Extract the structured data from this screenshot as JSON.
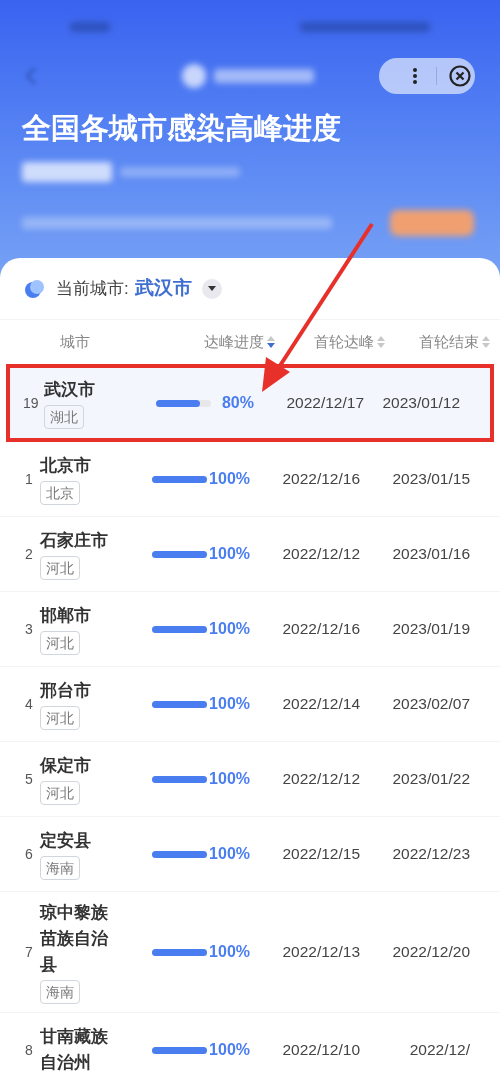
{
  "header": {
    "title": "全国各城市感染高峰进度"
  },
  "current_city": {
    "label": "当前城市:",
    "value": "武汉市"
  },
  "columns": [
    {
      "label": "城市",
      "sorted": false,
      "sortable": false
    },
    {
      "label": "达峰进度",
      "sorted": true,
      "sortable": true
    },
    {
      "label": "首轮达峰",
      "sorted": false,
      "sortable": true
    },
    {
      "label": "首轮结束",
      "sorted": false,
      "sortable": true
    }
  ],
  "rows": [
    {
      "rank": "19",
      "city": "武汉市",
      "province": "湖北",
      "level": 0.8,
      "percent": "80%",
      "peak": "2022/12/17",
      "end": "2023/01/12",
      "highlighted": true
    },
    {
      "rank": "1",
      "city": "北京市",
      "province": "北京",
      "level": 1,
      "percent": "100%",
      "peak": "2022/12/16",
      "end": "2023/01/15",
      "highlighted": false
    },
    {
      "rank": "2",
      "city": "石家庄市",
      "province": "河北",
      "level": 1,
      "percent": "100%",
      "peak": "2022/12/12",
      "end": "2023/01/16",
      "highlighted": false
    },
    {
      "rank": "3",
      "city": "邯郸市",
      "province": "河北",
      "level": 1,
      "percent": "100%",
      "peak": "2022/12/16",
      "end": "2023/01/19",
      "highlighted": false
    },
    {
      "rank": "4",
      "city": "邢台市",
      "province": "河北",
      "level": 1,
      "percent": "100%",
      "peak": "2022/12/14",
      "end": "2023/02/07",
      "highlighted": false
    },
    {
      "rank": "5",
      "city": "保定市",
      "province": "河北",
      "level": 1,
      "percent": "100%",
      "peak": "2022/12/12",
      "end": "2023/01/22",
      "highlighted": false
    },
    {
      "rank": "6",
      "city": "定安县",
      "province": "海南",
      "level": 1,
      "percent": "100%",
      "peak": "2022/12/15",
      "end": "2022/12/23",
      "highlighted": false
    },
    {
      "rank": "7",
      "city": "琼中黎族苗族自治县",
      "province": "海南",
      "level": 1,
      "percent": "100%",
      "peak": "2022/12/13",
      "end": "2022/12/20",
      "highlighted": false
    },
    {
      "rank": "8",
      "city": "甘南藏族自治州",
      "level": 1,
      "percent": "100%",
      "peak": "2022/12/10",
      "end": "2022/12/",
      "highlighted": false
    }
  ]
}
